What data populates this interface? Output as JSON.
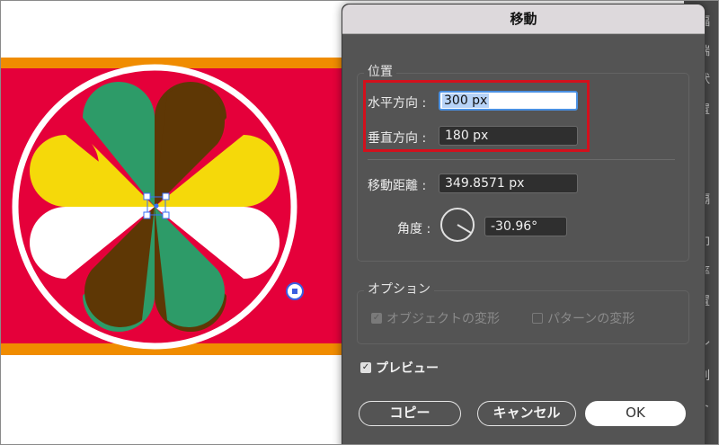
{
  "dialog": {
    "title": "移動",
    "position_group": "位置",
    "horizontal_label": "水平方向 :",
    "horizontal_value": "300 px",
    "vertical_label": "垂直方向 :",
    "vertical_value": "180 px",
    "distance_label": "移動距離 :",
    "distance_value": "349.8571 px",
    "angle_label": "角度 :",
    "angle_value": "-30.96°",
    "options_group": "オプション",
    "transform_objects": "オブジェクトの変形",
    "transform_patterns": "パターンの変形",
    "preview": "プレビュー",
    "copy_button": "コピー",
    "cancel_button": "キャンセル",
    "ok_button": "OK"
  },
  "right_panel": {
    "snippets": [
      "幅",
      "端",
      "状",
      "置",
      "隔",
      "印",
      "率",
      "置",
      "ル",
      "列",
      "ト"
    ]
  },
  "colors": {
    "banner_red": "#e5003a",
    "banner_orange": "#f08c00",
    "petal_green": "#2d9b68",
    "petal_brown": "#5e3705",
    "petal_yellow": "#f5d90a",
    "petal_white": "#ffffff",
    "dialog_bg": "#545454",
    "highlight_red": "#d3101c"
  }
}
